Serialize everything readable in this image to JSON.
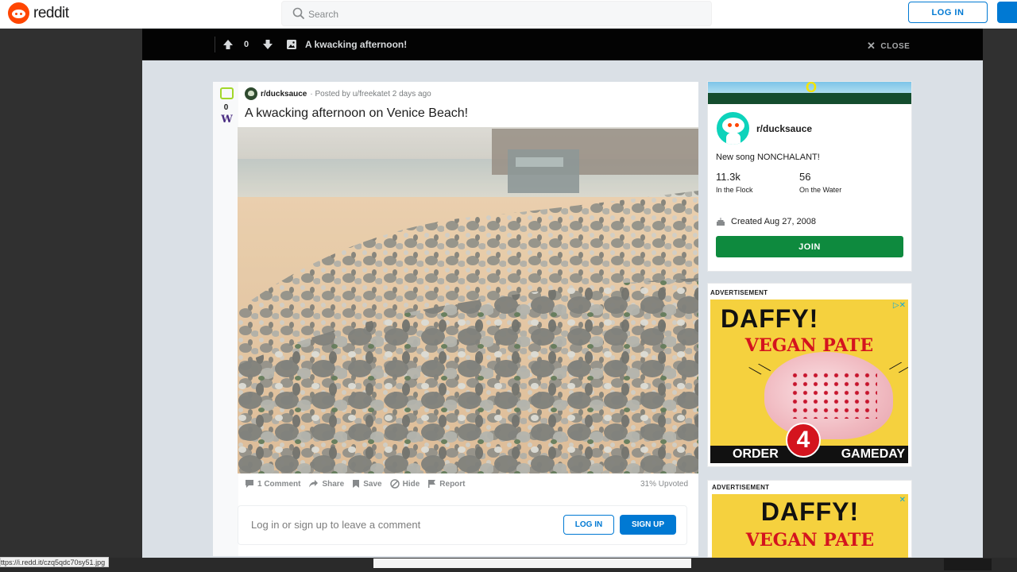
{
  "header": {
    "logo_text": "reddit",
    "search_placeholder": "Search",
    "login_label": "LOG IN"
  },
  "overlay_bar": {
    "score": "0",
    "title": "A kwacking afternoon!",
    "close_label": "CLOSE"
  },
  "post": {
    "vote_score": "0",
    "subreddit": "r/ducksauce",
    "posted_by": "· Posted by u/freekatet 2 days ago",
    "title": "A kwacking afternoon on Venice Beach!",
    "actions": {
      "comments": "1 Comment",
      "share": "Share",
      "save": "Save",
      "hide": "Hide",
      "report": "Report"
    },
    "upvoted": "31% Upvoted",
    "comment_prompt": "Log in or sign up to leave a comment",
    "comment_login": "LOG IN",
    "comment_signup": "SIGN UP"
  },
  "sidebar": {
    "subreddit": "r/ducksauce",
    "description": "New song NONCHALANT!",
    "members": "11.3k",
    "members_label": "In the Flock",
    "online": "56",
    "online_label": "On the Water",
    "created": "Created Aug 27, 2008",
    "join_label": "JOIN"
  },
  "ads": [
    {
      "label": "ADVERTISEMENT",
      "headline": "DAFFY!",
      "subhead": "VEGAN PATE",
      "badge": "4",
      "bottom_left": "ORDER",
      "bottom_right": "GAMEDAY"
    },
    {
      "label": "ADVERTISEMENT",
      "headline": "DAFFY!",
      "subhead": "VEGAN PATE"
    }
  ],
  "status": {
    "url": "ttps://i.redd.it/czq5qdc70sy51.jpg"
  },
  "colors": {
    "brand": "#ff4500",
    "accent_blue": "#0079d3",
    "join_green": "#0e8a3e",
    "overlay": "#030303",
    "ad_yellow": "#f5d13e",
    "ad_red": "#d4141e"
  },
  "icons": [
    "reddit-logo-icon",
    "search-icon",
    "upvote-icon",
    "downvote-icon",
    "image-icon",
    "close-icon",
    "comment-icon",
    "share-icon",
    "save-icon",
    "hide-icon",
    "report-icon",
    "cake-icon",
    "ad-choices-icon"
  ]
}
